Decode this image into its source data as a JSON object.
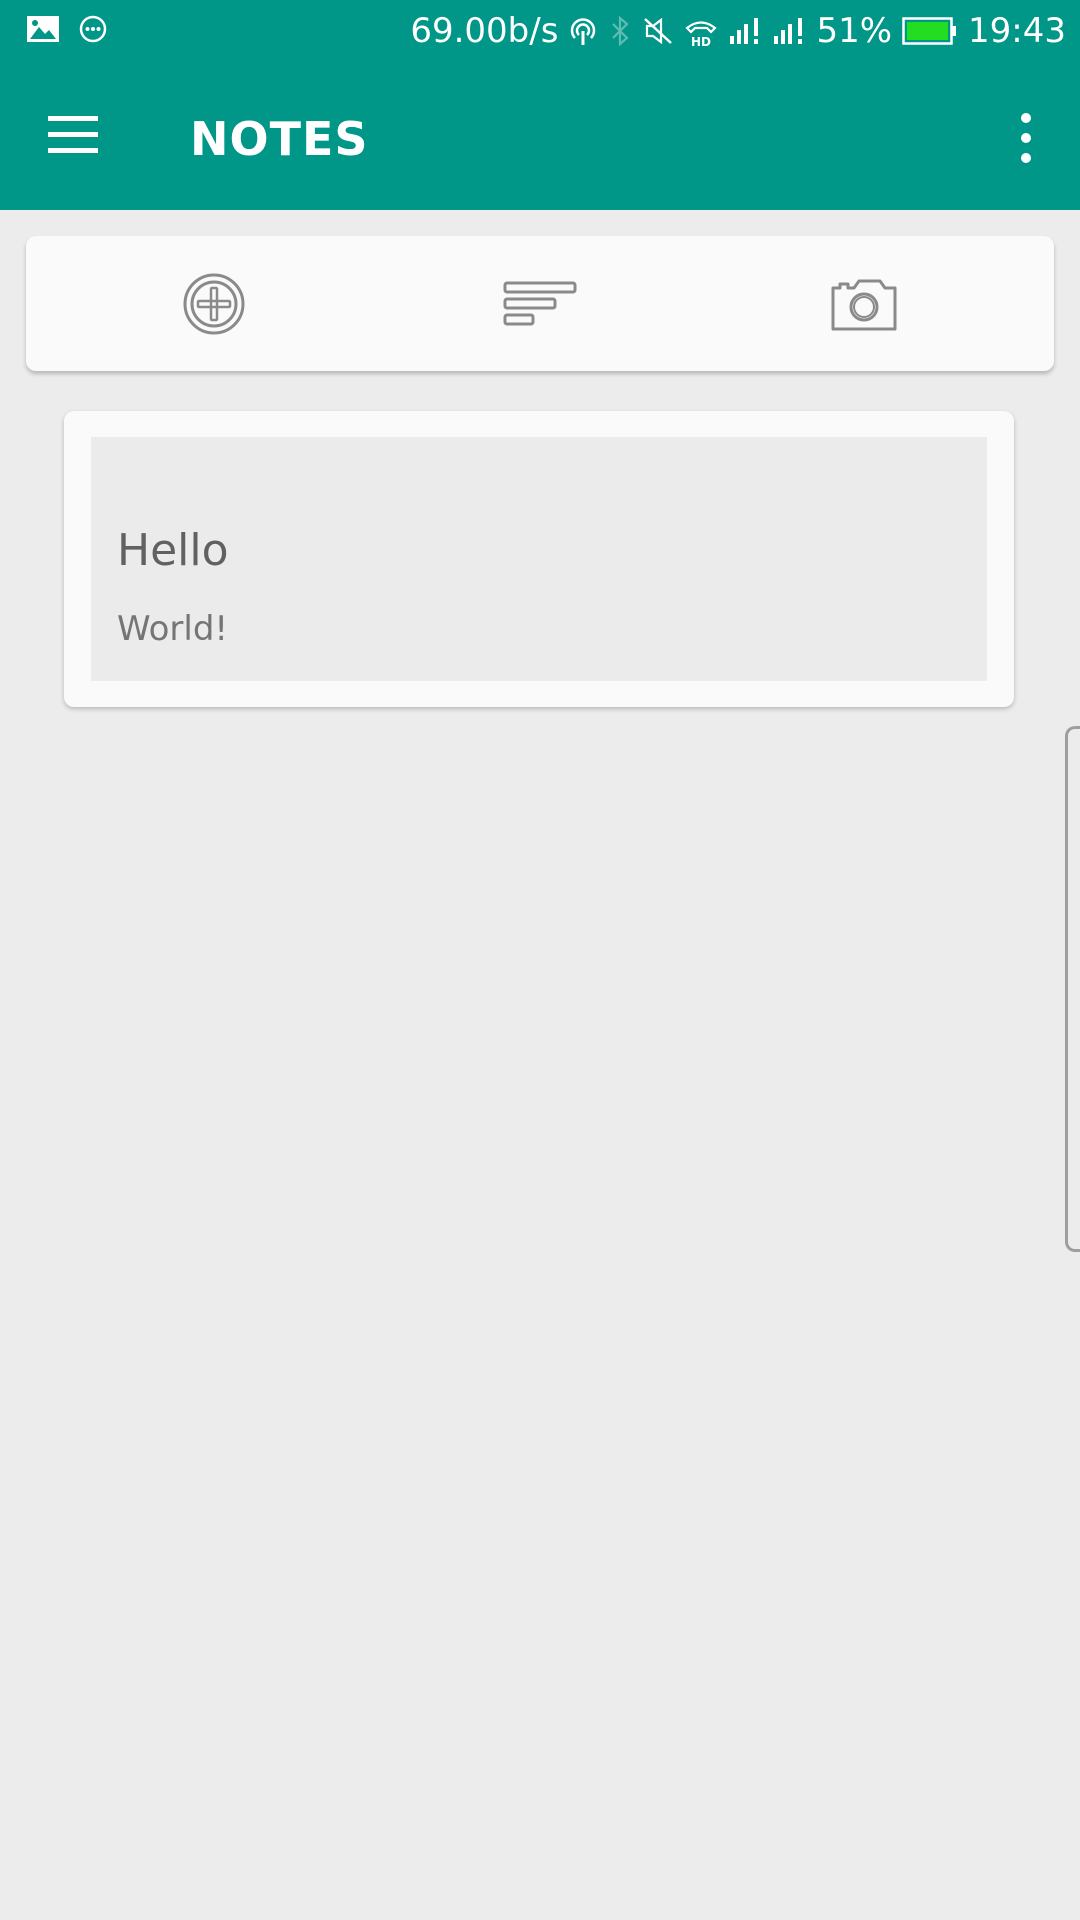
{
  "status_bar": {
    "net_speed": "69.00b/s",
    "battery_percent": "51%",
    "battery_level": 0.51,
    "time": "19:43",
    "icons": [
      "image-icon",
      "message-icon",
      "hotspot-icon",
      "bluetooth-icon",
      "mute-icon",
      "hd-call-icon",
      "signal-icon",
      "signal-icon",
      "battery-icon"
    ]
  },
  "app_bar": {
    "title": "NOTES",
    "color": "#009688",
    "icons": [
      "menu-icon",
      "more-vert-icon"
    ]
  },
  "quick_actions": {
    "icons": [
      "add-circle-icon",
      "text-note-icon",
      "camera-icon"
    ]
  },
  "notes": [
    {
      "title": "Hello",
      "body": "World!"
    }
  ]
}
